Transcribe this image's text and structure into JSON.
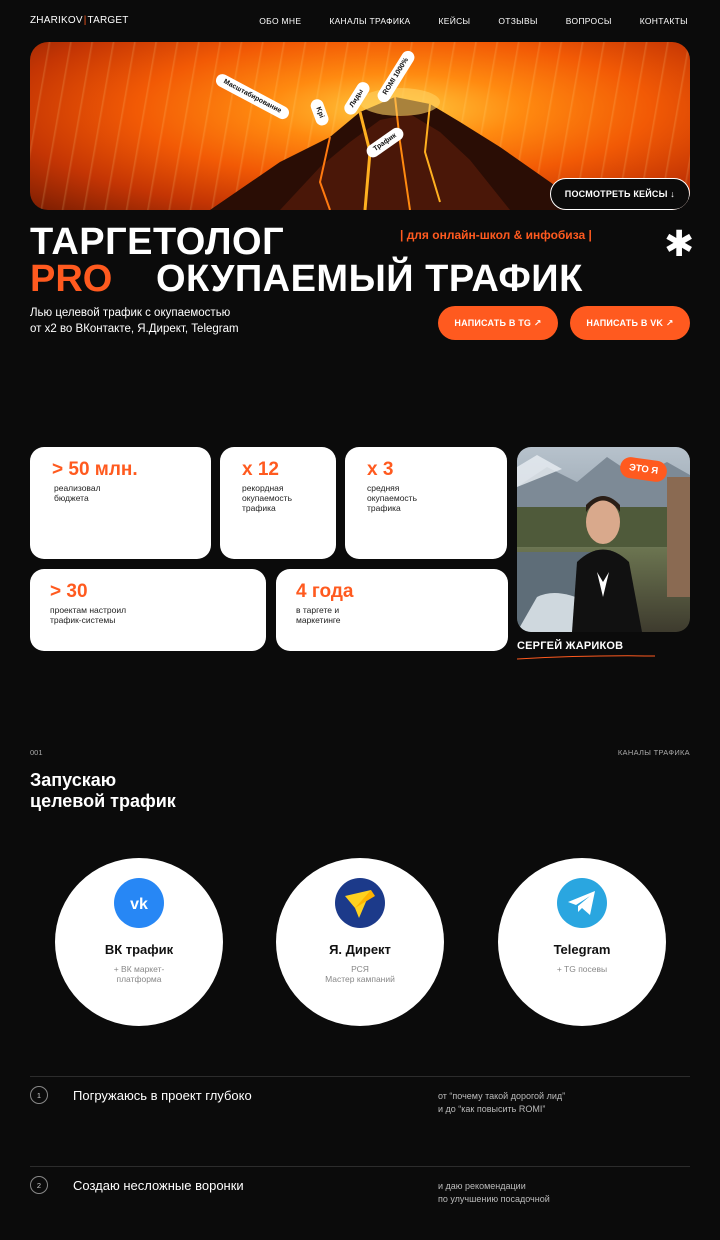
{
  "nav": {
    "logo_left": "ZHARIKOV",
    "logo_sep": "|",
    "logo_right": "TARGET",
    "links": [
      "ОБО МНЕ",
      "КАНАЛЫ ТРАФИКА",
      "КЕЙСЫ",
      "ОТЗЫВЫ",
      "ВОПРОСЫ",
      "КОНТАКТЫ"
    ]
  },
  "hero": {
    "tags": [
      "Масштабирование",
      "Kpi",
      "Лиды",
      "ROMI 1000%",
      "Трафик"
    ],
    "cases_button": "ПОСМОТРЕТЬ КЕЙСЫ ↓"
  },
  "headline": {
    "line1": "ТАРГЕТОЛОГ",
    "pro": "PRO",
    "line2": "ОКУПАЕМЫЙ ТРАФИК",
    "for_tag": "| для онлайн-школ & инфобиза |",
    "asterisk": "✱",
    "lead_line1": "Лью целевой трафик с окупаемостью",
    "lead_line2": "от х2 во ВКонтакте, Я.Директ, Telegram",
    "btn_tg": "НАПИСАТЬ В TG ↗",
    "btn_vk": "НАПИСАТЬ В VK ↗"
  },
  "stats": [
    {
      "num": "> 50 млн.",
      "d1": "реализовал",
      "d2": "бюджета",
      "d3": ""
    },
    {
      "num": "x 12",
      "d1": "рекордная",
      "d2": "окупаемость",
      "d3": "трафика"
    },
    {
      "num": "x 3",
      "d1": "средняя",
      "d2": "окупаемость",
      "d3": "трафика"
    },
    {
      "num": "> 30",
      "d1": "проектам настроил",
      "d2": "трафик-системы",
      "d3": ""
    },
    {
      "num": "4 года",
      "d1": "в таргете и",
      "d2": "маркетинге",
      "d3": ""
    }
  ],
  "profile": {
    "badge": "ЭТО Я",
    "name": "СЕРГЕЙ ЖАРИКОВ"
  },
  "section": {
    "num": "001",
    "label": "КАНАЛЫ ТРАФИКА",
    "title_line1": "Запускаю",
    "title_line2": "целевой трафик"
  },
  "channels": [
    {
      "title": "ВК трафик",
      "sub1": "+ ВК маркет-",
      "sub2": "платформа",
      "icon": "vk-icon",
      "color": "#2787f5"
    },
    {
      "title": "Я. Директ",
      "sub1": "РСЯ",
      "sub2": "Мастер кампаний",
      "icon": "yandex-direct-icon",
      "color": "#1c3a8a"
    },
    {
      "title": "Telegram",
      "sub1": "+ TG посевы",
      "sub2": "",
      "icon": "telegram-icon",
      "color": "#2aa6e0"
    }
  ],
  "steps": [
    {
      "num": "1",
      "title": "Погружаюсь в проект глубоко",
      "note1": "от “почему такой дорогой лид”",
      "note2": "и до “как повысить ROMI”"
    },
    {
      "num": "2",
      "title": "Создаю несложные воронки",
      "note1": "и даю рекомендации",
      "note2": "по улучшению посадочной"
    }
  ],
  "colors": {
    "accent": "#ff5a1f",
    "background": "#0b0b0b",
    "card": "#ffffff"
  }
}
